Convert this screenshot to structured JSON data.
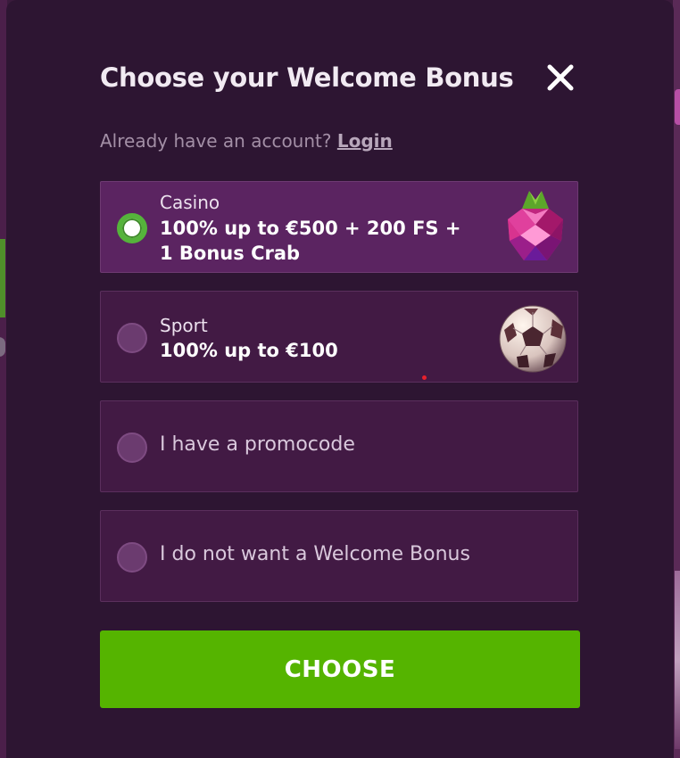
{
  "modal": {
    "title": "Choose your Welcome Bonus",
    "login_prompt": "Already have an account?",
    "login_link": "Login",
    "close_icon": "close-icon"
  },
  "options": [
    {
      "category": "Casino",
      "offer_line1": "100% up to €500 + 200 FS +",
      "offer_line2": "1 Bonus Crab",
      "icon": "raspberry-gem-icon",
      "selected": true
    },
    {
      "category": "Sport",
      "offer_line1": "100% up to €100",
      "icon": "soccer-ball-icon",
      "selected": false
    },
    {
      "label": "I have a promocode",
      "selected": false
    },
    {
      "label": "I do not want a Welcome Bonus",
      "selected": false
    }
  ],
  "choose_button": "CHOOSE",
  "colors": {
    "modal_bg": "#2d1532",
    "option_bg": "#421a44",
    "option_selected_bg": "#5b2461",
    "accent_green": "#55b400",
    "text": "#f1eaf2"
  }
}
